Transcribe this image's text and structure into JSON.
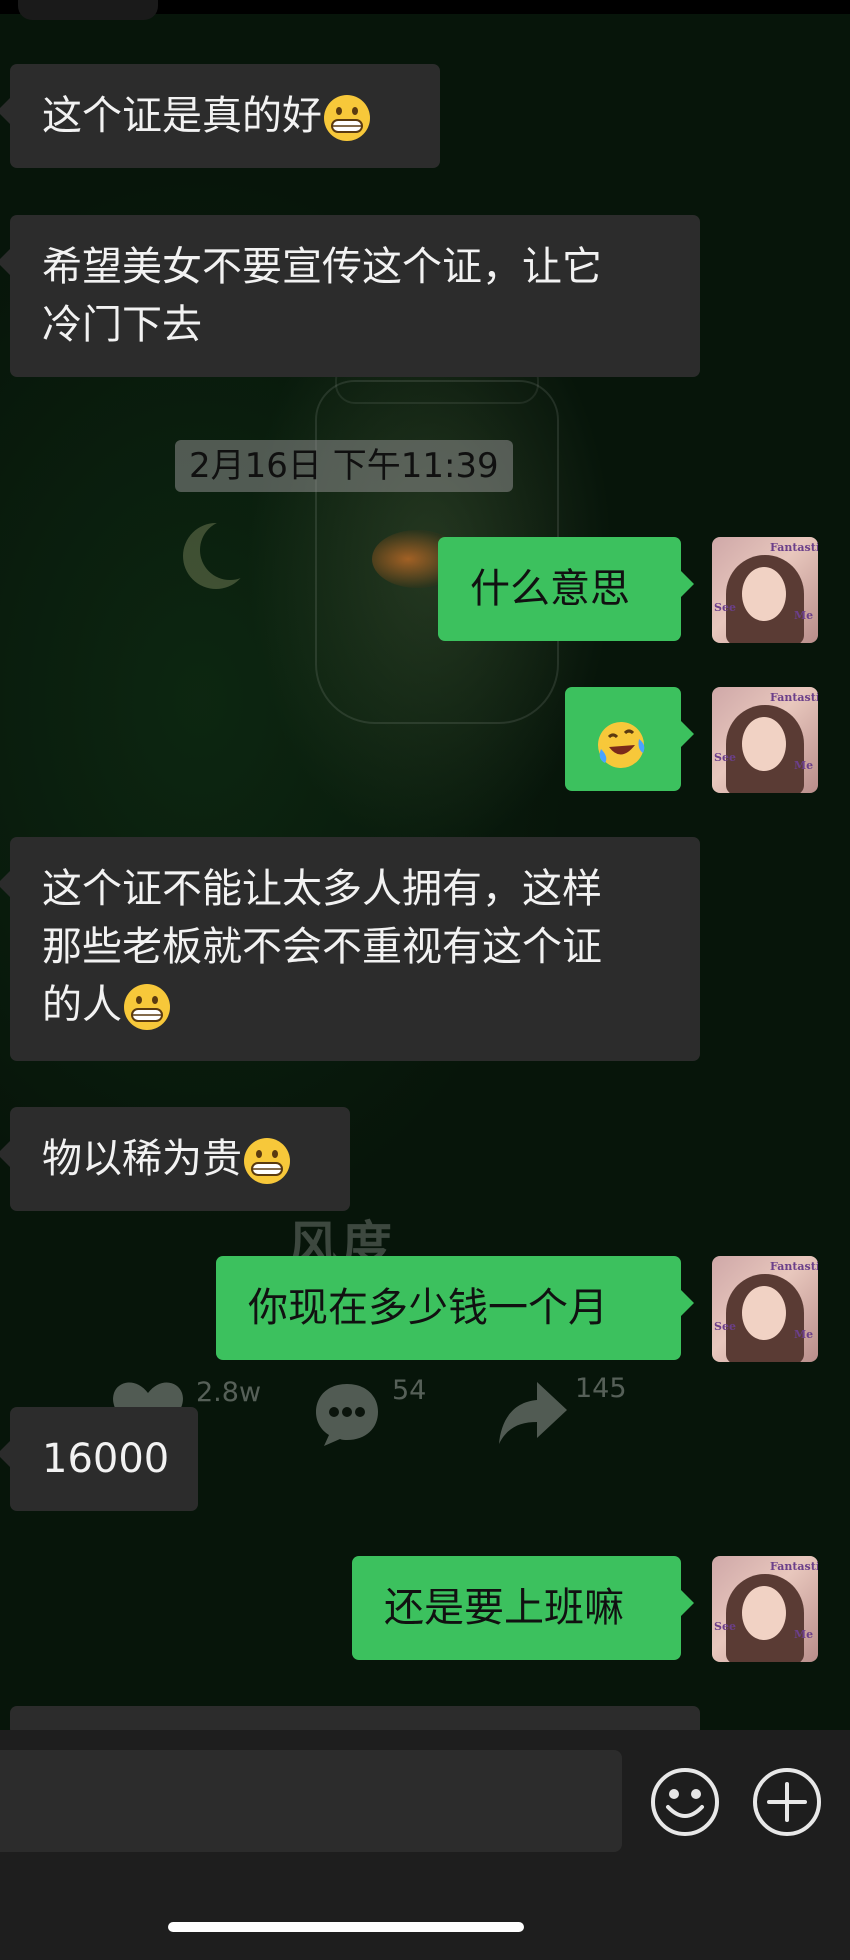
{
  "messages": [
    {
      "side": "left",
      "text": "这个证是真的好",
      "emoji": "grinning-emoji"
    },
    {
      "side": "left",
      "lines": [
        "希望美女不要宣传这个证，让它",
        "冷门下去"
      ]
    },
    {
      "side": "right",
      "text": "什么意思"
    },
    {
      "side": "right",
      "emoji": "crying-laughing-emoji"
    },
    {
      "side": "left",
      "lines": [
        "这个证不能让太多人拥有，这样",
        "那些老板就不会不重视有这个证",
        "的人"
      ],
      "emoji": "grinning-emoji"
    },
    {
      "side": "left",
      "text": "物以稀为贵",
      "emoji": "grinning-emoji"
    },
    {
      "side": "right",
      "text": "你现在多少钱一个月"
    },
    {
      "side": "left",
      "text": "16000"
    },
    {
      "side": "right",
      "text": "还是要上班嘛"
    }
  ],
  "timestamp": "2月16日 下午11:39",
  "background": {
    "watermark": "风度",
    "likes": "2.8w",
    "comments": "54",
    "shares": "145"
  },
  "avatar_text": {
    "top": "Fantastic",
    "left": "See",
    "right": "Me"
  },
  "colors": {
    "sent": "#3cc15e",
    "received": "#2c2c2c",
    "background": "#07150a"
  }
}
